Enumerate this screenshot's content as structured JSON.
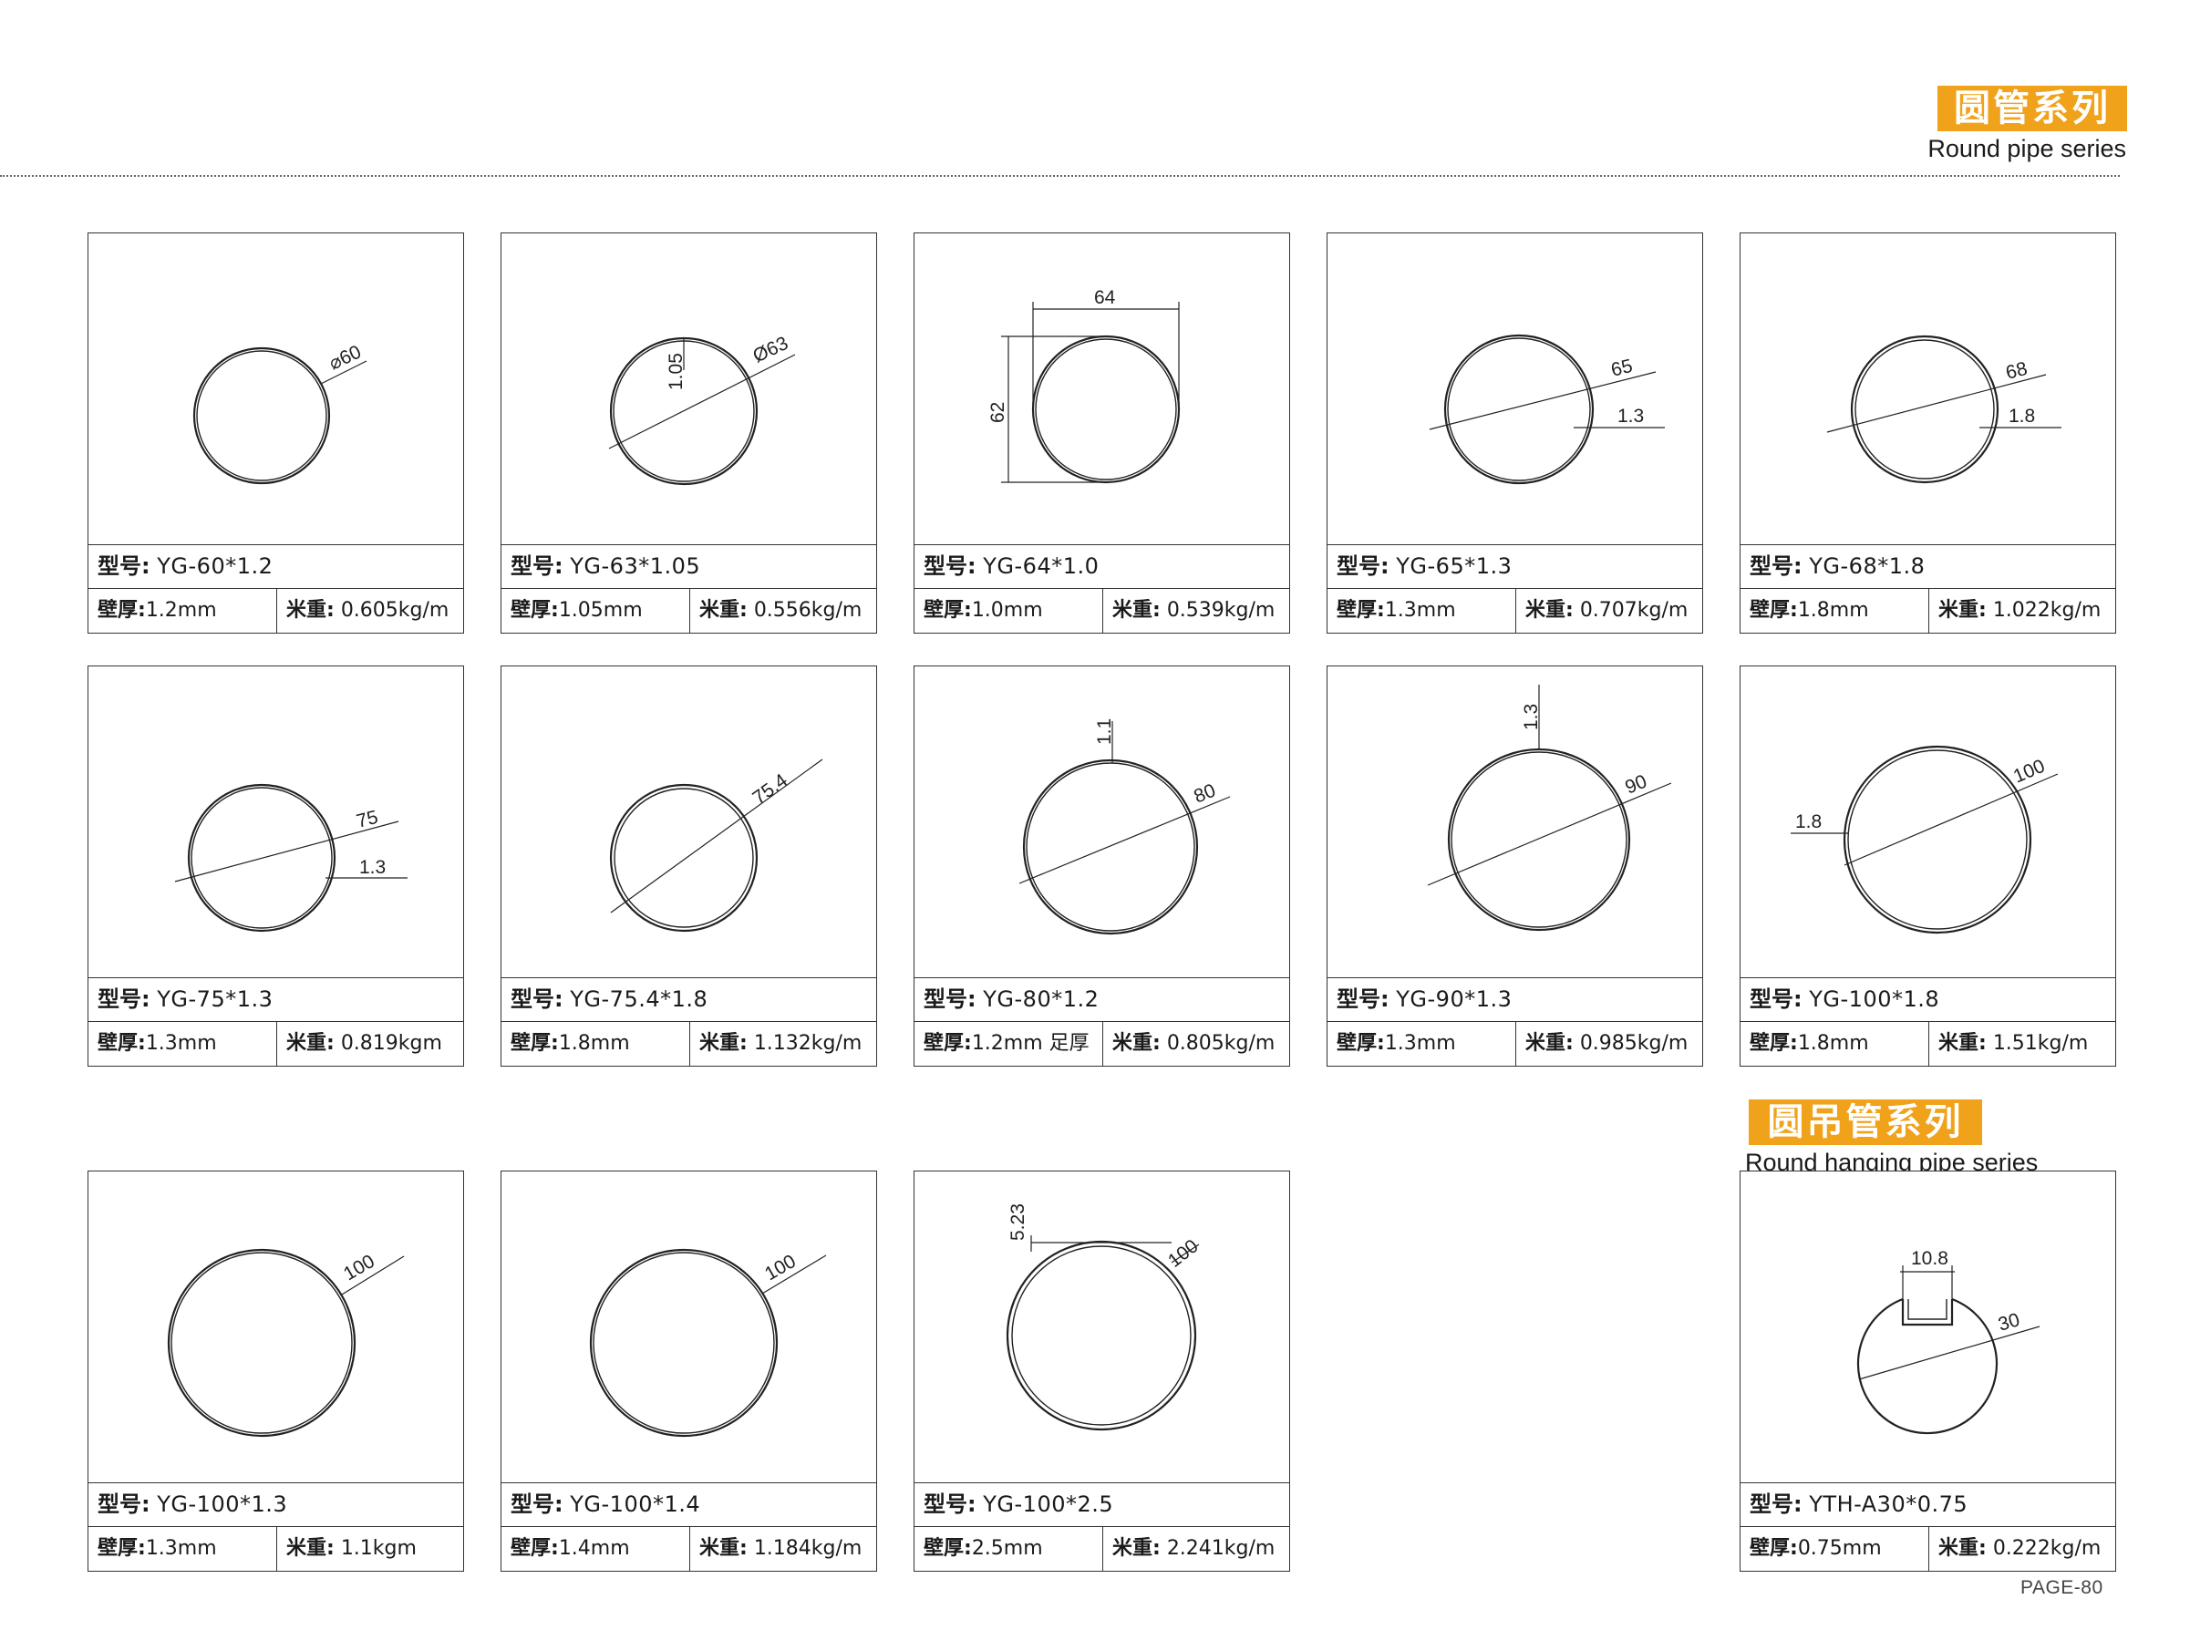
{
  "header": {
    "title_cn": "圆管系列",
    "title_en": "Round pipe series",
    "accent_color": "#f0a21a"
  },
  "section2": {
    "title_cn": "圆吊管系列",
    "title_en": "Round hanging pipe series"
  },
  "labels": {
    "model": "型号:",
    "wall": "壁厚:",
    "weight": "米重:"
  },
  "products": [
    {
      "model": "YG-60*1.2",
      "wall": "1.2mm",
      "weight": "0.605kg/m",
      "dims": [
        "⌀60"
      ]
    },
    {
      "model": "YG-63*1.05",
      "wall": "1.05mm",
      "weight": "0.556kg/m",
      "dims": [
        "Ø63",
        "1.05"
      ]
    },
    {
      "model": "YG-64*1.0",
      "wall": "1.0mm",
      "weight": "0.539kg/m",
      "dims": [
        "64",
        "62"
      ]
    },
    {
      "model": "YG-65*1.3",
      "wall": "1.3mm",
      "weight": "0.707kg/m",
      "dims": [
        "65",
        "1.3"
      ]
    },
    {
      "model": "YG-68*1.8",
      "wall": "1.8mm",
      "weight": "1.022kg/m",
      "dims": [
        "68",
        "1.8"
      ]
    },
    {
      "model": "YG-75*1.3",
      "wall": "1.3mm",
      "weight": "0.819kgm",
      "dims": [
        "75",
        "1.3"
      ]
    },
    {
      "model": "YG-75.4*1.8",
      "wall": "1.8mm",
      "weight": "1.132kg/m",
      "dims": [
        "75.4"
      ]
    },
    {
      "model": "YG-80*1.2",
      "wall": "1.2mm 足厚",
      "weight": "0.805kg/m",
      "dims": [
        "80",
        "1.1"
      ]
    },
    {
      "model": "YG-90*1.3",
      "wall": "1.3mm",
      "weight": "0.985kg/m",
      "dims": [
        "90",
        "1.3"
      ]
    },
    {
      "model": "YG-100*1.8",
      "wall": "1.8mm",
      "weight": "1.51kg/m",
      "dims": [
        "100",
        "1.8"
      ]
    },
    {
      "model": "YG-100*1.3",
      "wall": "1.3mm",
      "weight": "1.1kgm",
      "dims": [
        "100"
      ]
    },
    {
      "model": "YG-100*1.4",
      "wall": "1.4mm",
      "weight": "1.184kg/m",
      "dims": [
        "100"
      ]
    },
    {
      "model": "YG-100*2.5",
      "wall": "2.5mm",
      "weight": "2.241kg/m",
      "dims": [
        "100",
        "5.23"
      ]
    },
    {
      "model": "YTH-A30*0.75",
      "wall": "0.75mm",
      "weight": "0.222kg/m",
      "dims": [
        "30",
        "10.8"
      ]
    }
  ],
  "footer": {
    "page": "PAGE-80"
  }
}
